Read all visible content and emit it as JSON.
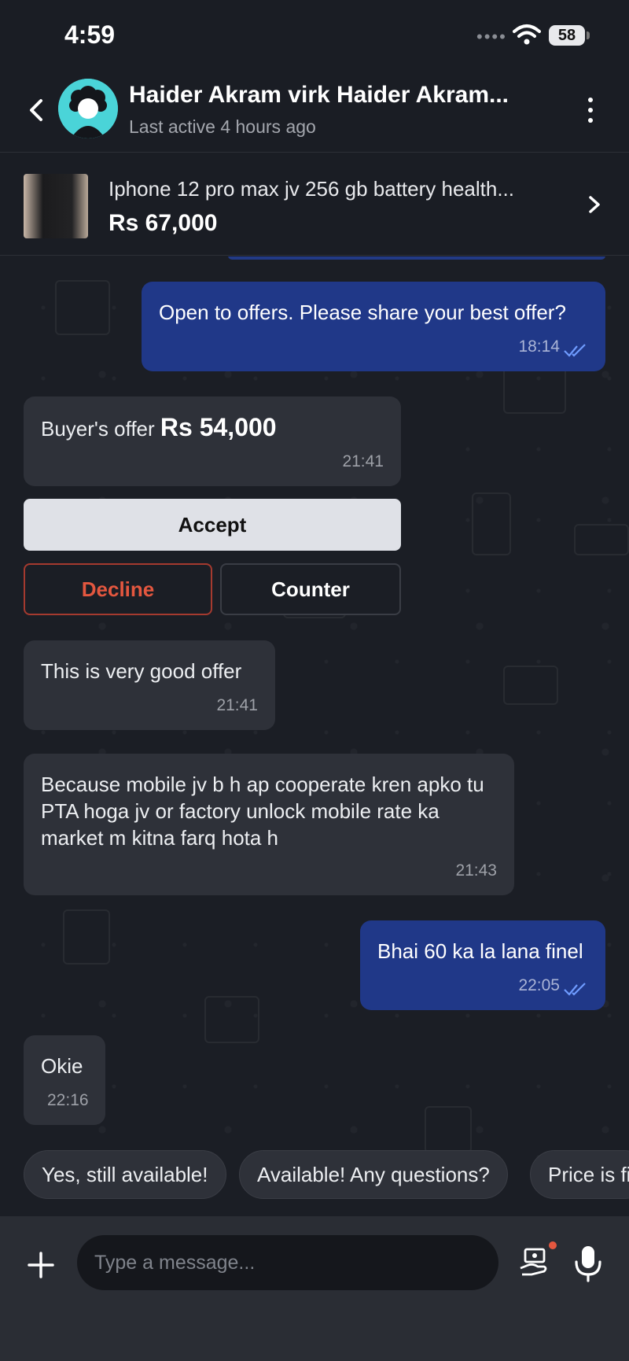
{
  "status_bar": {
    "time": "4:59",
    "battery": "58",
    "signal_icon": "signal-dots-icon",
    "wifi_icon": "wifi-icon"
  },
  "header": {
    "contact_name": "Haider Akram virk Haider Akram...",
    "last_active": "Last active 4 hours ago",
    "back_icon": "chevron-left-icon",
    "more_icon": "more-vertical-icon"
  },
  "product": {
    "title": "Iphone 12 pro max jv 256 gb battery health...",
    "price": "Rs 67,000"
  },
  "messages": [
    {
      "text": "Open to offers. Please share your best offer?",
      "time": "18:14",
      "direction": "out"
    },
    {
      "label": "Buyer's offer",
      "amount": "Rs 54,000",
      "time": "21:41",
      "direction": "in"
    },
    {
      "text": "This is very good offer",
      "time": "21:41",
      "direction": "in"
    },
    {
      "text": "Because mobile jv b h ap cooperate kren apko tu PTA hoga jv or factory unlock mobile rate ka market m kitna farq hota h",
      "time": "21:43",
      "direction": "in"
    },
    {
      "text": "Bhai 60 ka la lana finel",
      "time": "22:05",
      "direction": "out"
    },
    {
      "text": "Okie",
      "time": "22:16",
      "direction": "in"
    }
  ],
  "offer_actions": {
    "accept": "Accept",
    "decline": "Decline",
    "counter": "Counter"
  },
  "quick_replies": [
    "Yes, still available!",
    "Available! Any questions?",
    "Price is fi"
  ],
  "composer": {
    "placeholder": "Type a message..."
  },
  "colors": {
    "outgoing_bubble": "#203888",
    "incoming_bubble": "#2e3139",
    "decline": "#e4573f",
    "background": "#1b1e25"
  }
}
